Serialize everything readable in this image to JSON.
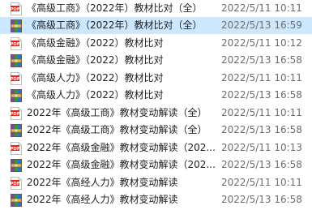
{
  "files": [
    {
      "name": "《高级工商》（2022年）教材比对（全）",
      "modified": "2022/5/11 10:11",
      "icon": "pdf-file-icon"
    },
    {
      "name": "《高级工商》（2022年）教材比对（全）",
      "modified": "2022/5/13 16:59",
      "icon": "winrar-archive-icon",
      "selected": true
    },
    {
      "name": "《高级金融》（2022）教材比对",
      "modified": "2022/5/11 10:12",
      "icon": "pdf-file-icon"
    },
    {
      "name": "《高级金融》（2022）教材比对",
      "modified": "2022/5/13 16:58",
      "icon": "winrar-archive-icon"
    },
    {
      "name": "《高级人力》（2022）教材比对",
      "modified": "2022/5/11 10:11",
      "icon": "pdf-file-icon"
    },
    {
      "name": "《高级人力》（2022）教材比对",
      "modified": "2022/5/13 16:58",
      "icon": "winrar-archive-icon"
    },
    {
      "name": "2022年《高级工商》教材变动解读（全）",
      "modified": "2022/5/11 10:11",
      "icon": "pdf-file-icon"
    },
    {
      "name": "2022年《高级工商》教材变动解读（全）",
      "modified": "2022/5/13 16:58",
      "icon": "winrar-archive-icon"
    },
    {
      "name": "2022年《高级金融》教材变动解读（202...",
      "modified": "2022/5/11 10:13",
      "icon": "pdf-file-icon"
    },
    {
      "name": "2022年《高级金融》教材变动解读（202...",
      "modified": "2022/5/13 16:58",
      "icon": "winrar-archive-icon"
    },
    {
      "name": "2022年《高经人力》教材变动解读",
      "modified": "2022/5/11 10:11",
      "icon": "pdf-file-icon"
    },
    {
      "name": "2022年《高经人力》教材变动解读",
      "modified": "2022/5/13 16:58",
      "icon": "winrar-archive-icon"
    }
  ],
  "colors": {
    "selection": "#cce8ff",
    "pdf_red": "#e1251b",
    "rar_purple": "#8b3fa0",
    "rar_green": "#2e9a3b",
    "rar_blue": "#2f6fd0"
  }
}
